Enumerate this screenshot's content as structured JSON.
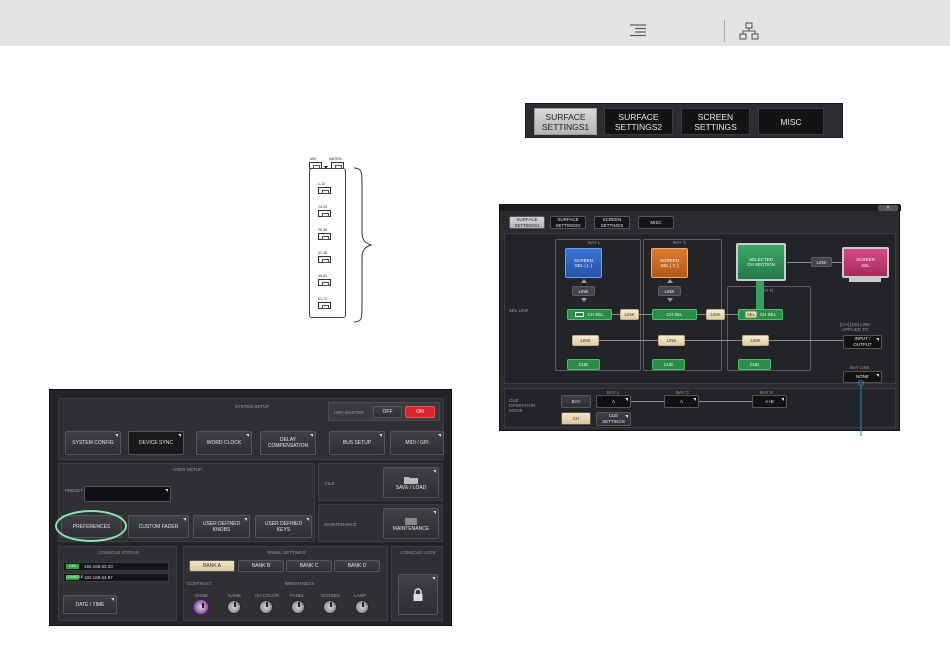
{
  "header": {
    "icons": [
      "list-icon",
      "hierarchy-icon"
    ]
  },
  "tabs": [
    {
      "label_line1": "SURFACE",
      "label_line2": "SETTINGS1",
      "active": true
    },
    {
      "label_line1": "SURFACE",
      "label_line2": "SETTINGS2",
      "active": false
    },
    {
      "label_line1": "SCREEN",
      "label_line2": "SETTINGS",
      "active": false
    },
    {
      "label_line1": "MISC",
      "label_line2": "",
      "active": false
    }
  ],
  "strip": {
    "mix": "MIX",
    "matrix": "MATRIX",
    "rows": [
      "1-12",
      "13-24",
      "25-36",
      "37-48",
      "49-60",
      "61-72"
    ]
  },
  "system_setup": {
    "title": "SYSTEM SETUP",
    "phantom": "+48V MASTER",
    "off": "OFF",
    "on": "ON",
    "buttons": [
      "SYSTEM CONFIG",
      "DEVICE SYNC",
      "WORD CLOCK",
      "DELAY\nCOMPENSATION",
      "BUS SETUP",
      "MIDI / GPI"
    ],
    "user_setup": "USER SETUP",
    "preset": "PRESET",
    "preferences": "PREFERENCES",
    "custom_fader": "CUSTOM FADER",
    "user_knobs": "USER DEFINED\nKNOBS",
    "user_keys": "USER DEFINED\nKEYS",
    "file": "FILE",
    "save_load": "SAVE / LOAD",
    "maintenance_lbl": "MAINTENANCE",
    "maintenance_btn": "MAINTENANCE",
    "console_status": "CONSOLE STATUS",
    "ip1_tag": "CS1",
    "ip1": "192.168.53.33",
    "ip2_tag": "CONSOLE",
    "ip2": "192.168.53.97",
    "date_time": "DATE / TIME",
    "panel_settings": "PANEL SETTINGS",
    "banks": [
      "BANK A",
      "BANK B",
      "BANK C",
      "BANK D"
    ],
    "contrast": "CONTRAST",
    "brightness": "BRIGHTNESS",
    "knob_labels": [
      "NAME",
      "NAME",
      "CH COLOR",
      "PANEL",
      "SCREEN",
      "LAMP"
    ],
    "console_lock": "CONSOLE LOCK"
  },
  "sel_link": {
    "tabs": [
      "SURFACE\nSETTINGS1",
      "SURFACE\nSETTINGS2",
      "SCREEN\nSETTINGS",
      "MISC"
    ],
    "sel_link_label": "SEL LINK",
    "bay_l": "BAY L",
    "bay_c": "BAY C",
    "bay_r": "BAY R",
    "screen_sel_l": "SCREEN\nSEL ( L )",
    "screen_sel_c": "SCREEN\nSEL ( C )",
    "selected_ch": "SELECTED\nCH SECTION",
    "screen_sel": "SCREEN\nSEL",
    "link": "LINK",
    "ch_sel": "CH SEL",
    "cue": "CUE",
    "sel": "SEL",
    "applied_to": "[CH] [DS] LINK\nAPPLIED TO",
    "input_output": "INPUT /\nOUTPUT",
    "bay_link": "BAY LINK",
    "none": "NONE",
    "cue_mode_label": "CUE\nOPERATION\nMODE",
    "bay_btn": "BAY",
    "ch_btn": "CH",
    "bay_l_val": "A",
    "bay_c_val": "A",
    "bay_r_val": "A+B",
    "cue_settings": "CUE\nSETTINGS"
  }
}
